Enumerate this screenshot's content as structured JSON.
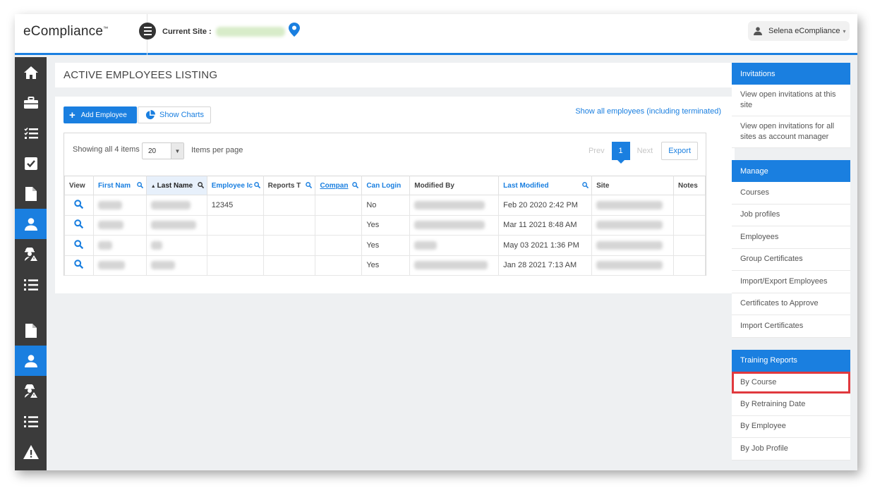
{
  "header": {
    "logo": "eCompliance",
    "logo_tm": "™",
    "current_site_label": "Current Site :",
    "user_name": "Selena eCompliance",
    "user_caret": "▾"
  },
  "sidebar": {
    "items": [
      {
        "icon": "home-icon",
        "active": false
      },
      {
        "icon": "briefcase-icon",
        "active": false
      },
      {
        "icon": "checklist-icon",
        "active": false
      },
      {
        "icon": "checkbox-icon",
        "active": false
      },
      {
        "icon": "document-icon",
        "active": false
      },
      {
        "icon": "user-icon",
        "active": true
      },
      {
        "icon": "user-hardhat-icon",
        "active": false
      },
      {
        "icon": "list-icon",
        "active": false
      },
      {
        "icon": "document-icon",
        "active": false
      },
      {
        "icon": "user-icon",
        "active": true
      },
      {
        "icon": "user-hardhat-icon",
        "active": false
      },
      {
        "icon": "list-icon",
        "active": false
      },
      {
        "icon": "warning-icon",
        "active": false
      }
    ]
  },
  "page": {
    "title": "ACTIVE EMPLOYEES LISTING",
    "add_employee": "Add Employee",
    "show_charts": "Show Charts",
    "show_all_link": "Show all employees (including terminated)"
  },
  "grid": {
    "showing": "Showing all 4 items",
    "page_size": "20",
    "per_page": "Items per page",
    "prev": "Prev",
    "page": "1",
    "next": "Next",
    "export": "Export",
    "columns": [
      "View",
      "First Nam",
      "Last Name",
      "Employee Ic",
      "Reports T",
      "Compan",
      "Can Login",
      "Modified By",
      "Last Modified",
      "Site",
      "Notes"
    ],
    "rows": [
      {
        "employee_id": "12345",
        "can_login": "No",
        "last_modified": "Feb 20 2020 2:42 PM"
      },
      {
        "employee_id": "",
        "can_login": "Yes",
        "last_modified": "Mar 11 2021 8:48 AM"
      },
      {
        "employee_id": "",
        "can_login": "Yes",
        "last_modified": "May 03 2021 1:36 PM"
      },
      {
        "employee_id": "",
        "can_login": "Yes",
        "last_modified": "Jan 28 2021 7:13 AM"
      }
    ]
  },
  "panels": {
    "invitations": {
      "title": "Invitations",
      "items": [
        "View open invitations at this site",
        "View open invitations for all sites as account manager"
      ]
    },
    "manage": {
      "title": "Manage",
      "items": [
        "Courses",
        "Job profiles",
        "Employees",
        "Group Certificates",
        "Import/Export Employees",
        "Certificates to Approve",
        "Import Certificates"
      ]
    },
    "training_reports": {
      "title": "Training Reports",
      "items": [
        "By Course",
        "By Retraining Date",
        "By Employee",
        "By Job Profile"
      ]
    }
  },
  "colors": {
    "accent": "#1a7fe0",
    "sidebar": "#3b3b3b",
    "highlight": "#e0393e"
  }
}
